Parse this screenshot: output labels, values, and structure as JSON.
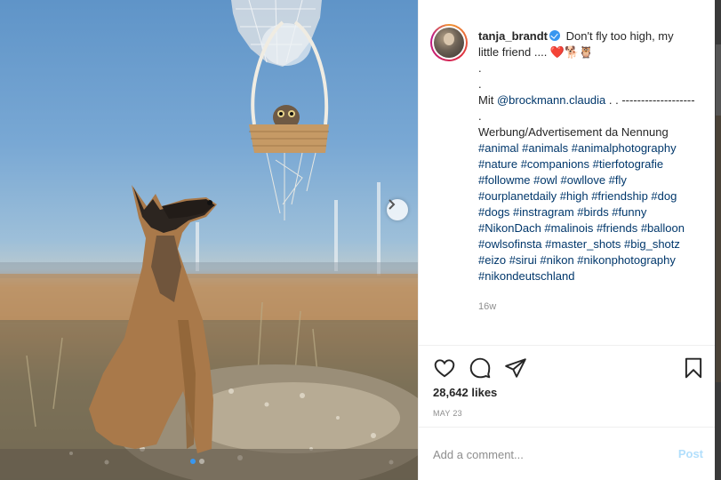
{
  "post": {
    "username": "tanja_brandt",
    "caption_first": "Don't fly too high, my little friend .... ❤️🐕🦉",
    "caption_dot1": ".",
    "caption_dot2": ".",
    "mit_prefix": "Mit ",
    "mention": "@brockmann.claudia",
    "mit_suffix": " . . ------------------- .",
    "werbung": "Werbung/Advertisement da Nennung",
    "hashtags": "#animal #animals #animalphotography #nature #companions #tierfotografie #followme #owl #owllove #fly #ourplanetdaily #high #friendship #dog #dogs #instragram #birds #funny #NikonDach #malinois #friends #balloon #owlsofinsta #master_shots #big_shotz #eizo #sirui #nikon #nikonphotography #nikondeutschland",
    "time_ago": "16w",
    "likes": "28,642 likes",
    "date": "MAY 23"
  },
  "comment": {
    "placeholder": "Add a comment...",
    "post_label": "Post"
  },
  "icons": {
    "like": "heart-icon",
    "comment": "comment-bubble-icon",
    "share": "paper-plane-icon",
    "save": "bookmark-icon",
    "next": "chevron-right-icon",
    "verified": "verified-badge-icon"
  },
  "colors": {
    "link": "#00376b",
    "verified": "#3897f0",
    "post_disabled": "#b2dffc",
    "muted": "#8e8e8e"
  },
  "carousel": {
    "slides": 2,
    "current": 1
  }
}
